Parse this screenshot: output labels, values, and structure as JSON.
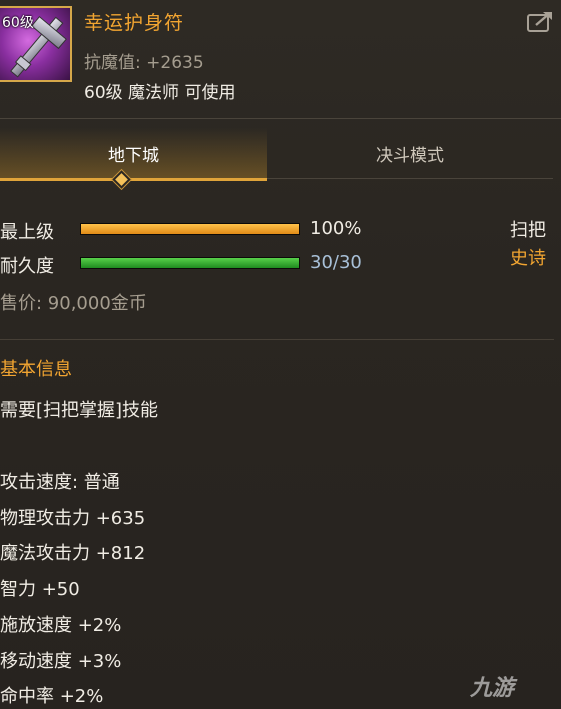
{
  "item": {
    "level_badge": "60级",
    "name": "幸运护身符",
    "stat_line": "抗魔值: +2635",
    "requirement": "60级 魔法师 可使用",
    "icon": "broom-weapon-icon"
  },
  "header": {
    "share_icon": "share-export-icon"
  },
  "tabs": [
    {
      "label": "地下城",
      "active": true
    },
    {
      "label": "决斗模式",
      "active": false
    }
  ],
  "bars": {
    "grade": {
      "label": "最上级",
      "value_text": "100%",
      "fill_fraction": 1.0,
      "color": "#f0a020"
    },
    "durability": {
      "label": "耐久度",
      "value_text": "30/30",
      "fill_fraction": 1.0,
      "color": "#3cb83a"
    }
  },
  "side": {
    "type": "扫把",
    "rarity": "史诗",
    "rarity_color": "#f2a531"
  },
  "price": "售价: 90,000金币",
  "basic_info": {
    "title": "基本信息",
    "lines": [
      "需要[扫把掌握]技能",
      "攻击速度: 普通",
      "物理攻击力 +635",
      "魔法攻击力 +812",
      "智力 +50",
      "施放速度 +2%",
      "移动速度 +3%",
      "命中率 +2%"
    ]
  },
  "watermark": "九游"
}
